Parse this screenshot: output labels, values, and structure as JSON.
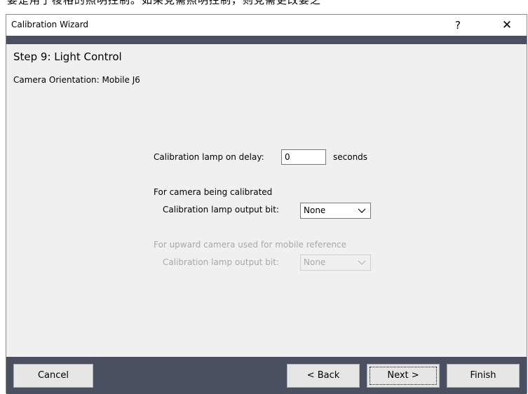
{
  "background_text": "要是用了棱格的照明控制。如果党需照明控制，则党需更改要之",
  "window": {
    "title": "Calibration Wizard",
    "help_glyph": "?",
    "close_glyph": "✕"
  },
  "step": {
    "title": "Step 9: Light Control",
    "orientation": "Camera Orientation: Mobile J6"
  },
  "delay": {
    "label": "Calibration lamp on delay:",
    "value": "0",
    "units": "seconds"
  },
  "camera_calibrated": {
    "heading": "For camera being calibrated",
    "output_label": "Calibration lamp output bit:",
    "output_value": "None",
    "enabled": true
  },
  "camera_upward": {
    "heading": "For upward camera used for mobile reference",
    "output_label": "Calibration lamp output bit:",
    "output_value": "None",
    "enabled": false
  },
  "buttons": {
    "cancel": "Cancel",
    "back": "< Back",
    "next": "Next >",
    "finish": "Finish"
  },
  "colors": {
    "bar": "#4a5060",
    "panel": "#f0f0f0",
    "button": "#e6e6e6",
    "disabled_text": "#a8a8a8"
  }
}
